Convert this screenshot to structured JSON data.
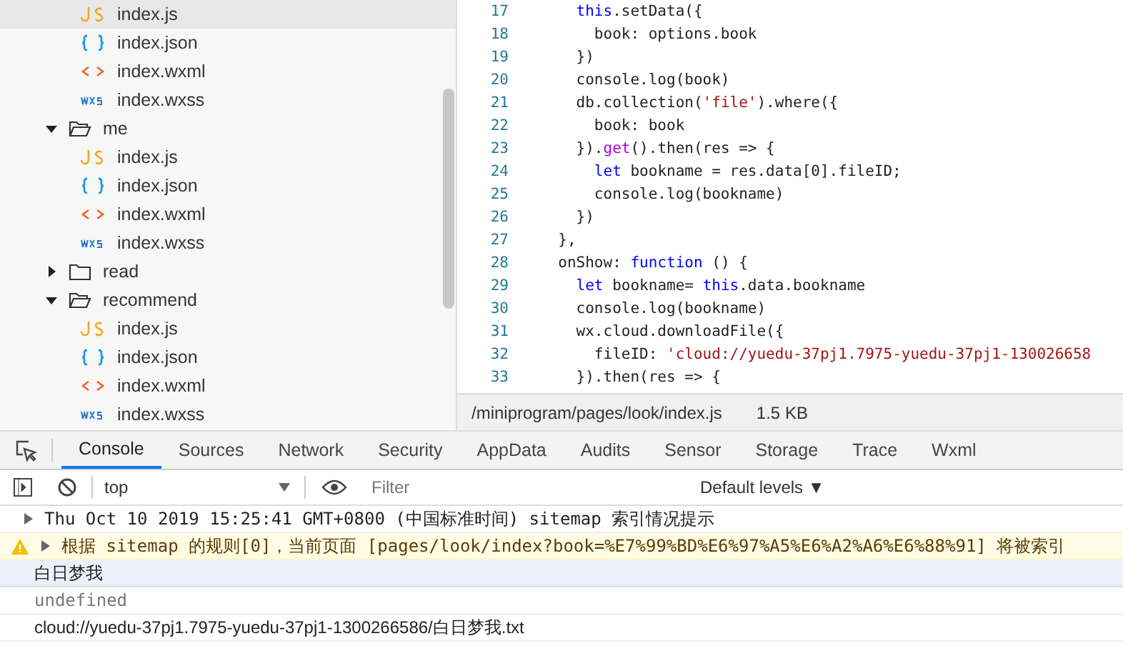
{
  "file_tree": {
    "items": [
      {
        "children": [
          {
            "name": "index.js",
            "kind": "js",
            "selected": true
          },
          {
            "name": "index.json",
            "kind": "json",
            "selected": false
          },
          {
            "name": "index.wxml",
            "kind": "wxml",
            "selected": false
          },
          {
            "name": "index.wxss",
            "kind": "wxss",
            "selected": false
          }
        ]
      },
      {
        "name": "me",
        "expanded": true,
        "children": [
          {
            "name": "index.js",
            "kind": "js",
            "selected": false
          },
          {
            "name": "index.json",
            "kind": "json",
            "selected": false
          },
          {
            "name": "index.wxml",
            "kind": "wxml",
            "selected": false
          },
          {
            "name": "index.wxss",
            "kind": "wxss",
            "selected": false
          }
        ]
      },
      {
        "name": "read",
        "expanded": false
      },
      {
        "name": "recommend",
        "expanded": true,
        "children": [
          {
            "name": "index.js",
            "kind": "js",
            "selected": false
          },
          {
            "name": "index.json",
            "kind": "json",
            "selected": false
          },
          {
            "name": "index.wxml",
            "kind": "wxml",
            "selected": false
          },
          {
            "name": "index.wxss",
            "kind": "wxss",
            "selected": false
          }
        ]
      }
    ]
  },
  "editor": {
    "lines": [
      {
        "number": "17",
        "tokens": [
          {
            "kind": "keyword",
            "text": "    this"
          },
          {
            "kind": "plain",
            "text": ".setData({"
          }
        ]
      },
      {
        "number": "18",
        "tokens": [
          {
            "kind": "plain",
            "text": "      book: options.book"
          }
        ]
      },
      {
        "number": "19",
        "tokens": [
          {
            "kind": "plain",
            "text": "    })"
          }
        ]
      },
      {
        "number": "20",
        "tokens": [
          {
            "kind": "plain",
            "text": "    console.log(book)"
          }
        ]
      },
      {
        "number": "21",
        "tokens": [
          {
            "kind": "plain",
            "text": "    db.collection("
          },
          {
            "kind": "string",
            "text": "'file'"
          },
          {
            "kind": "plain",
            "text": ").where({"
          }
        ]
      },
      {
        "number": "22",
        "tokens": [
          {
            "kind": "plain",
            "text": "      book: book"
          }
        ]
      },
      {
        "number": "23",
        "tokens": [
          {
            "kind": "plain",
            "text": "    })."
          },
          {
            "kind": "method",
            "text": "get"
          },
          {
            "kind": "plain",
            "text": "().then(res => {"
          }
        ]
      },
      {
        "number": "24",
        "tokens": [
          {
            "kind": "keyword",
            "text": "      let"
          },
          {
            "kind": "plain",
            "text": " bookname = res.data[0].fileID;"
          }
        ]
      },
      {
        "number": "25",
        "tokens": [
          {
            "kind": "plain",
            "text": "      console.log(bookname)"
          }
        ]
      },
      {
        "number": "26",
        "tokens": [
          {
            "kind": "plain",
            "text": "    })"
          }
        ]
      },
      {
        "number": "27",
        "tokens": [
          {
            "kind": "plain",
            "text": "  },"
          }
        ]
      },
      {
        "number": "28",
        "tokens": [
          {
            "kind": "plain",
            "text": "  onShow: "
          },
          {
            "kind": "keyword",
            "text": "function"
          },
          {
            "kind": "plain",
            "text": " () {"
          }
        ]
      },
      {
        "number": "29",
        "tokens": [
          {
            "kind": "keyword",
            "text": "    let"
          },
          {
            "kind": "plain",
            "text": " bookname= "
          },
          {
            "kind": "keyword",
            "text": "this"
          },
          {
            "kind": "plain",
            "text": ".data.bookname"
          }
        ]
      },
      {
        "number": "30",
        "tokens": [
          {
            "kind": "plain",
            "text": "    console.log(bookname)"
          }
        ]
      },
      {
        "number": "31",
        "tokens": [
          {
            "kind": "plain",
            "text": "    wx.cloud.downloadFile({"
          }
        ]
      },
      {
        "number": "32",
        "tokens": [
          {
            "kind": "plain",
            "text": "      fileID: "
          },
          {
            "kind": "string",
            "text": "'cloud://yuedu-37pj1.7975-yuedu-37pj1-130026658"
          }
        ]
      },
      {
        "number": "33",
        "tokens": [
          {
            "kind": "plain",
            "text": "    }).then(res => {"
          }
        ]
      }
    ]
  },
  "status_bar": {
    "path": "/miniprogram/pages/look/index.js",
    "size": "1.5 KB"
  },
  "devtools": {
    "tabs": [
      {
        "label": "Console",
        "selected": true
      },
      {
        "label": "Sources",
        "selected": false
      },
      {
        "label": "Network",
        "selected": false
      },
      {
        "label": "Security",
        "selected": false
      },
      {
        "label": "AppData",
        "selected": false
      },
      {
        "label": "Audits",
        "selected": false
      },
      {
        "label": "Sensor",
        "selected": false
      },
      {
        "label": "Storage",
        "selected": false
      },
      {
        "label": "Trace",
        "selected": false
      },
      {
        "label": "Wxml",
        "selected": false
      }
    ],
    "context": "top",
    "filter_placeholder": "Filter",
    "levels": "Default levels ▼"
  },
  "console": {
    "messages": [
      {
        "kind": "info",
        "text": "Thu Oct 10 2019 15:25:41 GMT+0800 (中国标准时间) sitemap 索引情况提示",
        "selected": false
      },
      {
        "kind": "warning",
        "text": "根据 sitemap 的规则[0]，当前页面 [pages/look/index?book=%E7%99%BD%E6%97%A5%E6%A2%A6%E6%88%91] 将被索引",
        "selected": false
      },
      {
        "kind": "log",
        "text": "白日梦我",
        "selected": true
      },
      {
        "kind": "value",
        "text": "undefined",
        "selected": false
      },
      {
        "kind": "log",
        "text": "cloud://yuedu-37pj1.7975-yuedu-37pj1-1300266586/白日梦我.txt",
        "selected": false
      }
    ]
  }
}
